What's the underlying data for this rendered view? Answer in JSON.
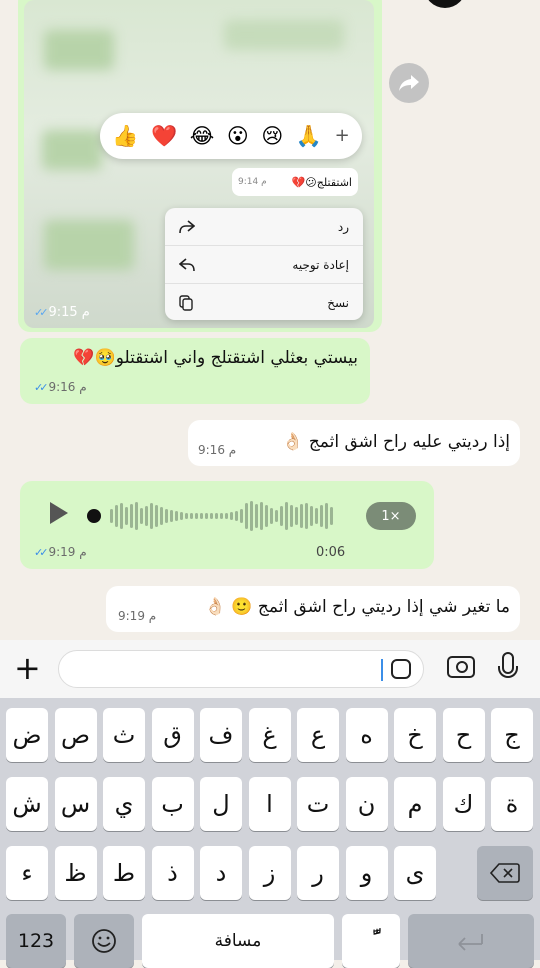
{
  "reaction_bar": {
    "emojis": [
      "👍",
      "❤️",
      "😂",
      "😮",
      "😢",
      "🙏"
    ],
    "more_label": "+"
  },
  "quoted": {
    "text": "اشتقتلج😕💔",
    "time": "9:14 م"
  },
  "context_menu": {
    "items": [
      {
        "label": "رد",
        "icon": "reply-icon"
      },
      {
        "label": "إعادة توجيه",
        "icon": "forward-icon"
      },
      {
        "label": "نسخ",
        "icon": "copy-icon"
      }
    ]
  },
  "image_message": {
    "time": "9:15 م"
  },
  "messages": [
    {
      "text": "بيستي بعثلي اشتقتلج واني اشتقتلو🥹💔",
      "time": "9:16 م",
      "direction": "out"
    },
    {
      "text": "إذا رديتي عليه راح اشق اثمج 👌🏻",
      "time": "9:16 م",
      "direction": "in"
    },
    {
      "text": "ما تغير شي إذا رديتي راح اشق اثمج 🙂 👌🏻",
      "time": "9:19 م",
      "direction": "in"
    }
  ],
  "voice_message": {
    "speed": "1×",
    "duration": "0:06",
    "time": "9:19 م"
  },
  "composer": {
    "placeholder": ""
  },
  "keyboard": {
    "row1": [
      "ض",
      "ص",
      "ث",
      "ق",
      "ف",
      "غ",
      "ع",
      "ه",
      "خ",
      "ح",
      "ج"
    ],
    "row2": [
      "ش",
      "س",
      "ي",
      "ب",
      "ل",
      "ا",
      "ت",
      "ن",
      "م",
      "ك",
      "ة"
    ],
    "row3": [
      "ء",
      "ظ",
      "ط",
      "ذ",
      "د",
      "ز",
      "ر",
      "و",
      "ى"
    ],
    "numbers_key": "123",
    "space_key": "مسافة",
    "diacritic_key": "ًّ"
  },
  "colors": {
    "outgoing_bubble": "#d8f7c8",
    "incoming_bubble": "#ffffff",
    "chat_background": "#f3efe9",
    "read_ticks": "#3b8ee8"
  }
}
